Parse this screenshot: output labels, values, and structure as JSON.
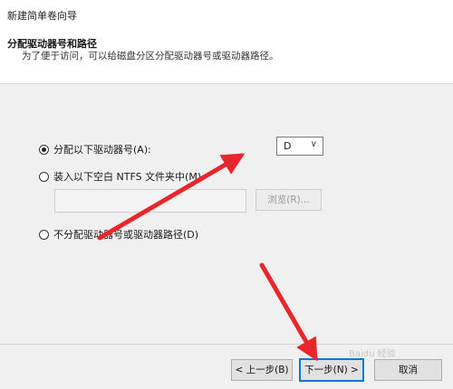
{
  "window": {
    "title": "新建简单卷向导"
  },
  "header": {
    "title": "分配驱动器号和路径",
    "subtitle": "为了便于访问，可以给磁盘分区分配驱动器号或驱动器路径。"
  },
  "options": {
    "assign_letter": {
      "label": "分配以下驱动器号(A):",
      "selected": true
    },
    "mount_folder": {
      "label": "装入以下空白 NTFS 文件夹中(M):",
      "selected": false
    },
    "no_assign": {
      "label": "不分配驱动器号或驱动器路径(D)",
      "selected": false
    }
  },
  "drive_letter": {
    "value": "D",
    "chevron": "∨"
  },
  "folder_path": {
    "value": ""
  },
  "browse_button": {
    "label": "浏览(R)..."
  },
  "footer": {
    "back_label": "< 上一步(B)",
    "next_label": "下一步(N) >",
    "cancel_label": "取消"
  },
  "watermark": "Baidu 经验",
  "colors": {
    "arrow": "#e8262c",
    "focus": "#0078d7"
  }
}
